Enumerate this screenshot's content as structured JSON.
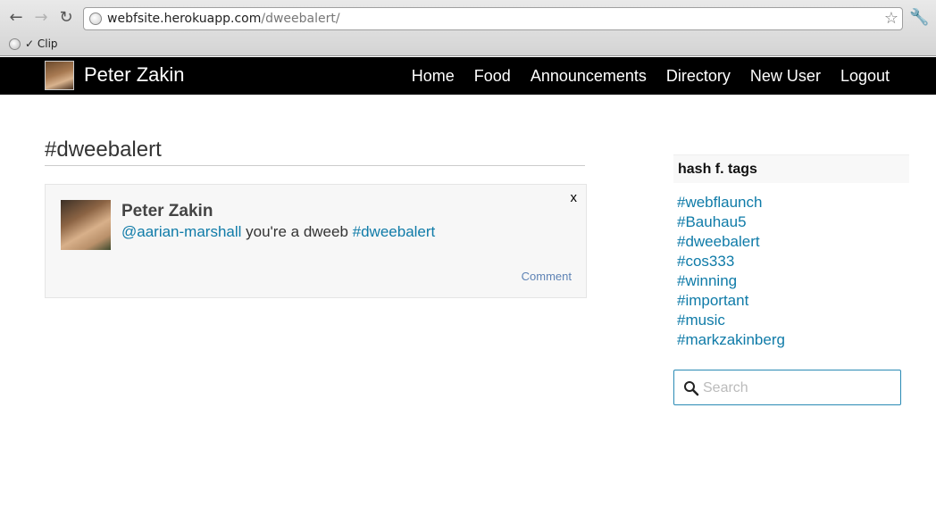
{
  "browser": {
    "url_host": "webfsite.herokuapp.com",
    "url_path": "/dweebalert/",
    "bookmark_label": "✓ Clip"
  },
  "header": {
    "brand_name": "Peter Zakin",
    "nav": [
      "Home",
      "Food",
      "Announcements",
      "Directory",
      "New User",
      "Logout"
    ]
  },
  "main": {
    "title": "#dweebalert",
    "post": {
      "author": "Peter Zakin",
      "mention": "@aarian-marshall",
      "text": " you're a dweeb ",
      "hashtag": "#dweebalert",
      "close": "x",
      "comment_label": "Comment"
    }
  },
  "sidebar": {
    "heading": "hash f. tags",
    "tags": [
      "#webflaunch",
      "#Bauhau5",
      "#dweebalert",
      "#cos333",
      "#winning",
      "#important",
      "#music",
      "#markzakinberg"
    ],
    "search_placeholder": "Search"
  }
}
